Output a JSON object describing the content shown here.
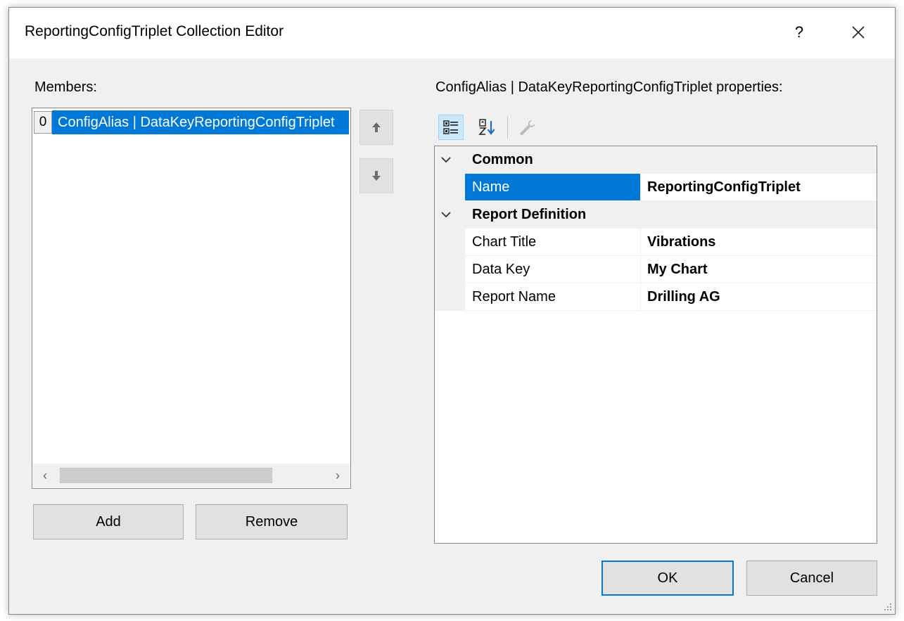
{
  "window": {
    "title": "ReportingConfigTriplet Collection Editor",
    "help_label": "?"
  },
  "members": {
    "label": "Members:",
    "items": [
      {
        "index": "0",
        "label": "ConfigAlias | DataKeyReportingConfigTriplet"
      }
    ],
    "scroll_left": "‹",
    "scroll_right": "›"
  },
  "buttons": {
    "add": "Add",
    "remove": "Remove",
    "ok": "OK",
    "cancel": "Cancel"
  },
  "properties": {
    "label": "ConfigAlias | DataKeyReportingConfigTriplet properties:",
    "categories": [
      {
        "name": "Common",
        "rows": [
          {
            "name": "Name",
            "value": "ReportingConfigTriplet"
          }
        ]
      },
      {
        "name": "Report Definition",
        "rows": [
          {
            "name": "Chart Title",
            "value": "Vibrations"
          },
          {
            "name": "Data Key",
            "value": "My Chart"
          },
          {
            "name": "Report Name",
            "value": "Drilling AG"
          }
        ]
      }
    ]
  },
  "colors": {
    "selection": "#0078d7",
    "dialog_background": "#f0f0f0",
    "default_button_border": "#0078d7"
  }
}
